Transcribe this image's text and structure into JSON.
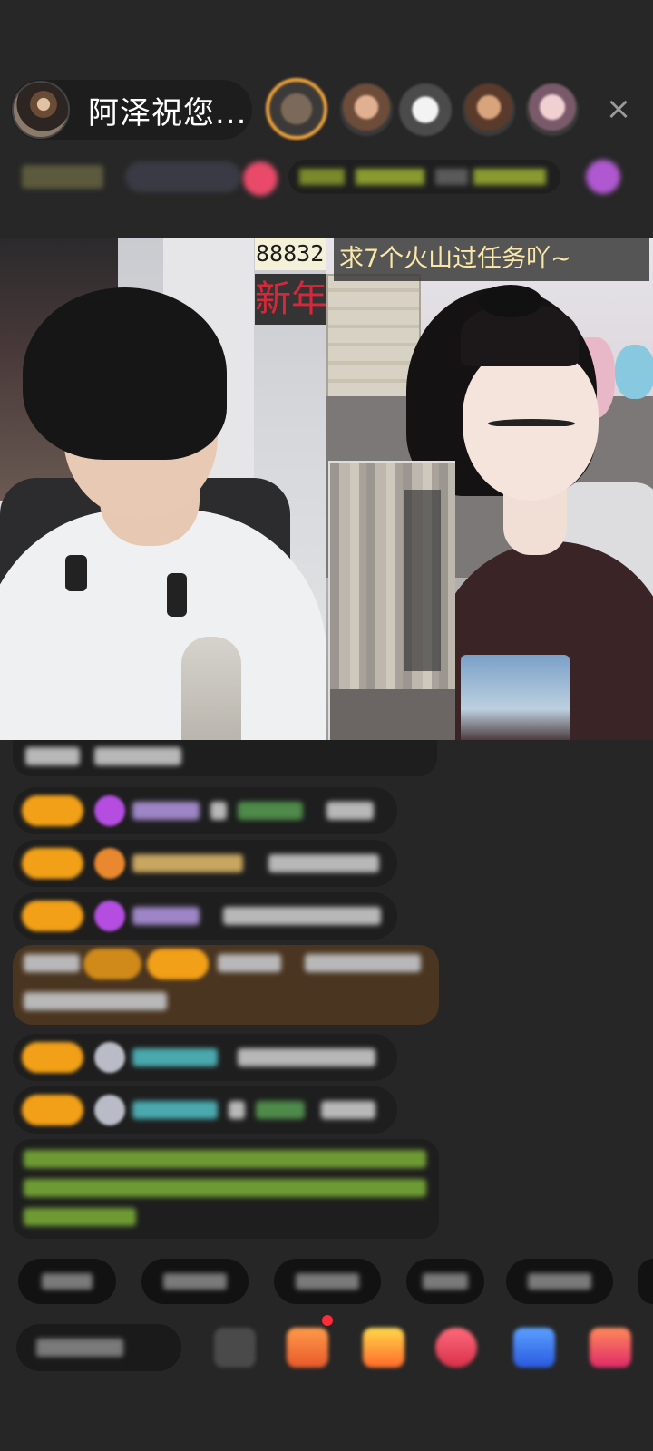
{
  "header": {
    "host_name": "阿泽祝您...",
    "close_glyph": "×"
  },
  "video": {
    "banner_text": "求7个火山过任务吖~",
    "score_text": "88832",
    "tag_text": "新年"
  },
  "colors": {
    "badge_orange": "#f2a018",
    "gift_purple": "#b44de0",
    "banner_text": "#fbe8a6",
    "tag_red": "#d6283a"
  }
}
